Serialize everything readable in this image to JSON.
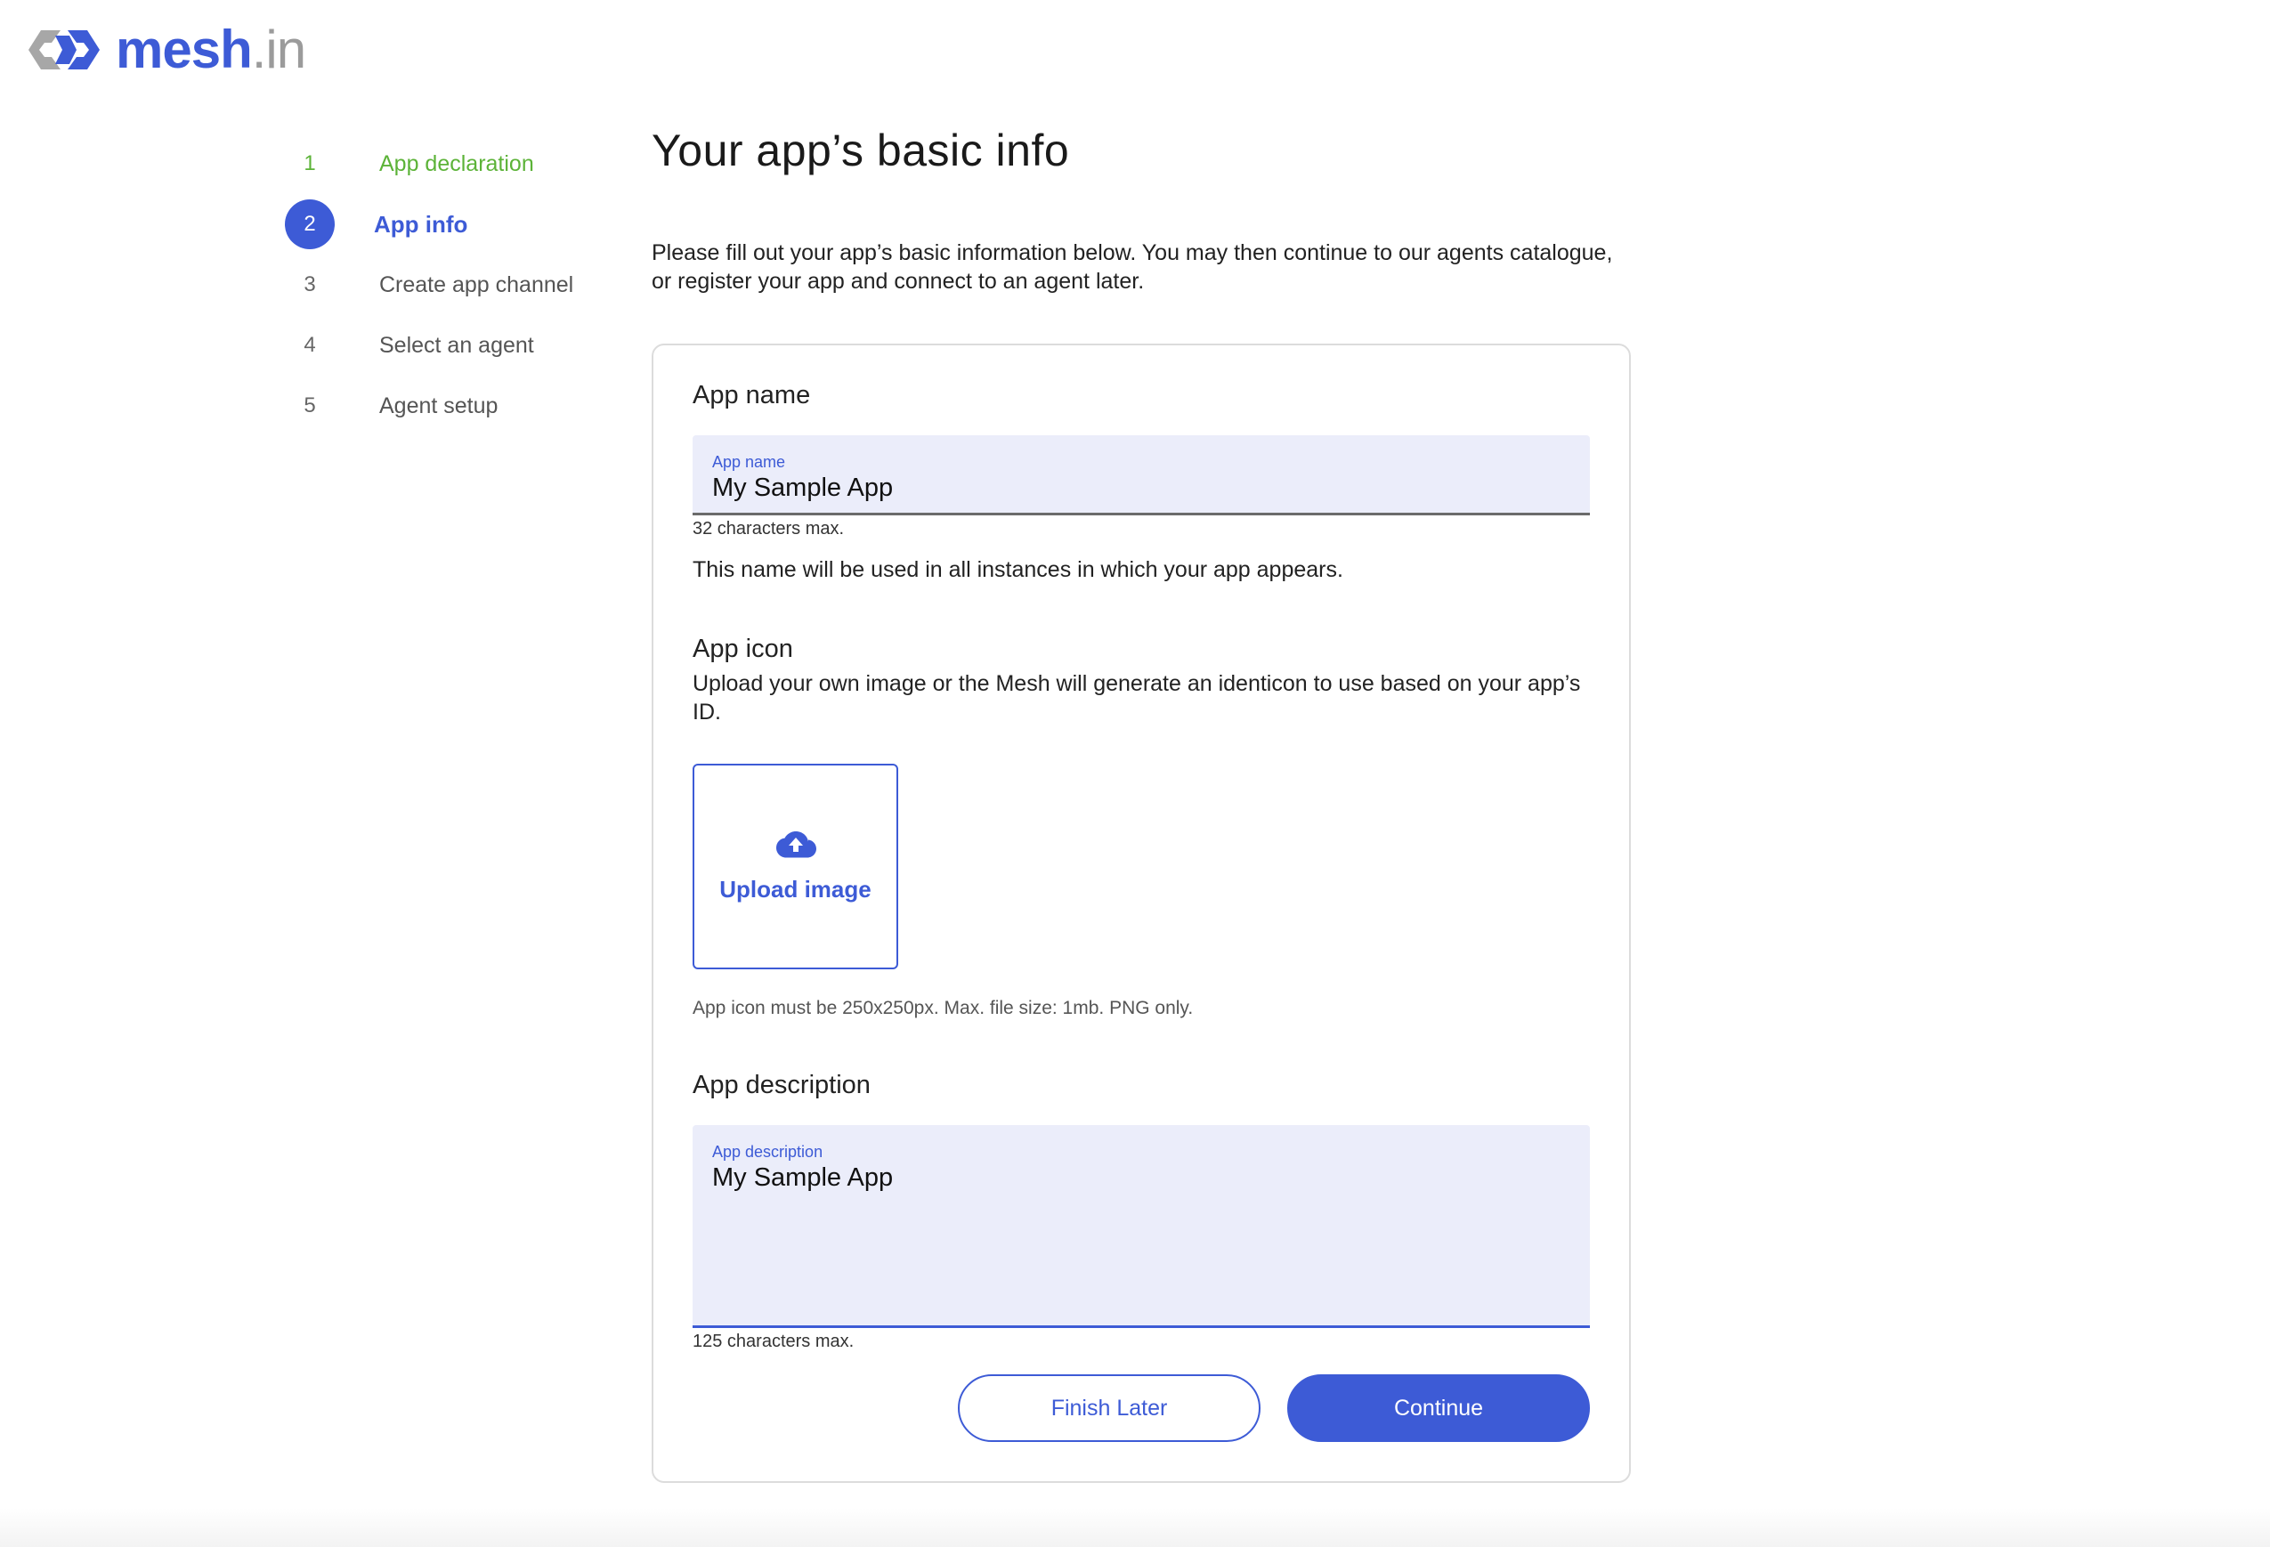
{
  "brand": {
    "name_main": "mesh",
    "name_suffix": ".in",
    "accent": "#3d5bd6"
  },
  "stepper": {
    "steps": [
      {
        "num": "1",
        "label": "App declaration",
        "state": "done"
      },
      {
        "num": "2",
        "label": "App info",
        "state": "active"
      },
      {
        "num": "3",
        "label": "Create app channel",
        "state": "pending"
      },
      {
        "num": "4",
        "label": "Select an agent",
        "state": "pending"
      },
      {
        "num": "5",
        "label": "Agent setup",
        "state": "pending"
      }
    ]
  },
  "main": {
    "title": "Your app’s basic info",
    "intro": "Please fill out your app’s basic information below. You may then continue to our agents catalogue, or register your app and connect to an agent later."
  },
  "app_name": {
    "section_title": "App name",
    "field_label": "App name",
    "value": "My Sample App",
    "limit": "32 characters max.",
    "help": "This name will be used in all instances in which your app appears."
  },
  "app_icon": {
    "section_title": "App icon",
    "description": "Upload your own image or the Mesh will generate an identicon to use based on your app’s ID.",
    "upload_label": "Upload image",
    "icon": "cloud-upload-icon",
    "note": "App icon must be 250x250px. Max. file size: 1mb. PNG only."
  },
  "app_description": {
    "section_title": "App description",
    "field_label": "App description",
    "value": "My Sample App",
    "limit": "125 characters max."
  },
  "actions": {
    "secondary": "Finish Later",
    "primary": "Continue"
  }
}
